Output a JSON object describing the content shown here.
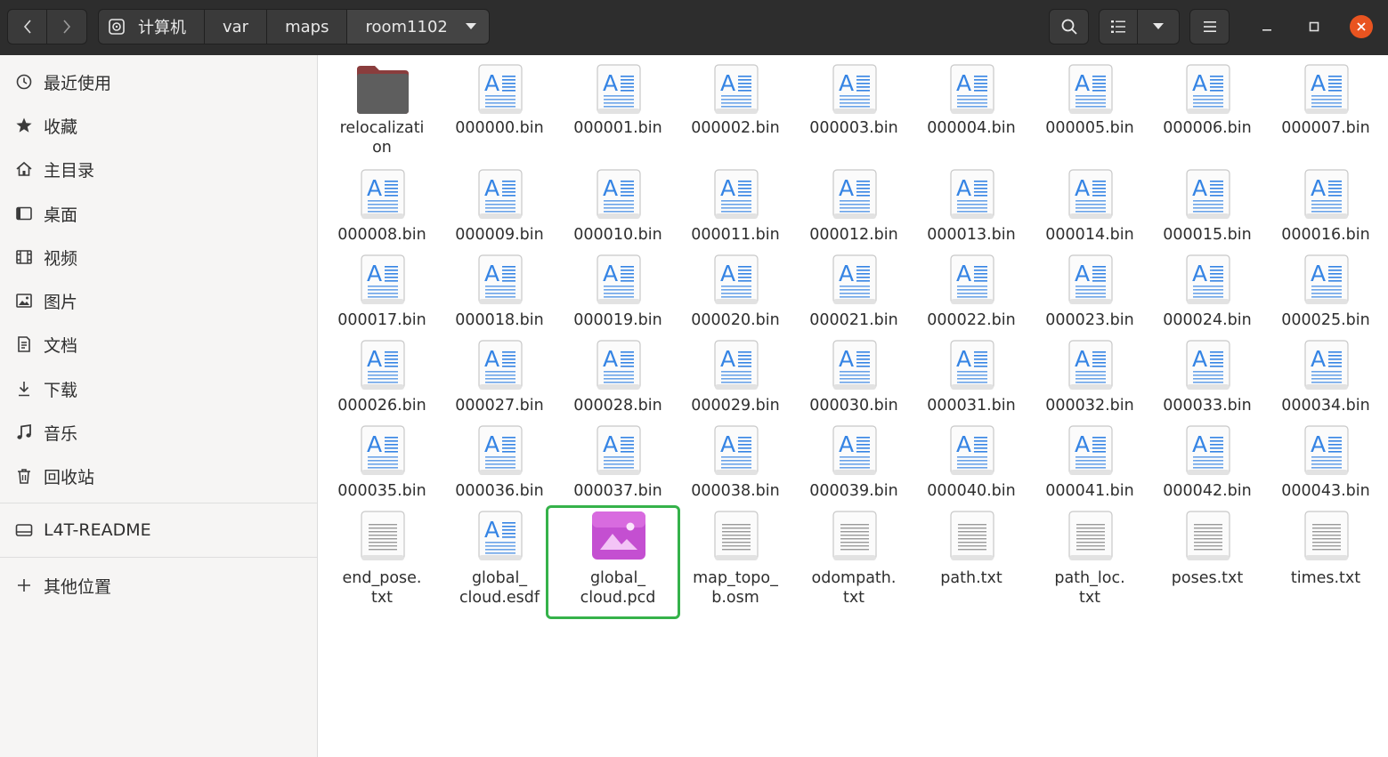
{
  "header": {
    "path": [
      "计算机",
      "var",
      "maps",
      "room1102"
    ],
    "icons": {
      "back": "chevron-left-icon",
      "forward": "chevron-right-icon",
      "search": "search-icon",
      "view": "list-view-icon",
      "menu": "hamburger-menu-icon"
    }
  },
  "sidebar": {
    "places": [
      {
        "label": "最近使用",
        "icon": "recent-icon"
      },
      {
        "label": "收藏",
        "icon": "star-icon"
      },
      {
        "label": "主目录",
        "icon": "home-icon"
      },
      {
        "label": "桌面",
        "icon": "desktop-icon"
      },
      {
        "label": "视频",
        "icon": "video-icon"
      },
      {
        "label": "图片",
        "icon": "pictures-icon"
      },
      {
        "label": "文档",
        "icon": "documents-icon"
      },
      {
        "label": "下载",
        "icon": "download-icon"
      },
      {
        "label": "音乐",
        "icon": "music-icon"
      },
      {
        "label": "回收站",
        "icon": "trash-icon"
      }
    ],
    "devices": [
      {
        "label": "L4T-README",
        "icon": "drive-icon"
      }
    ],
    "other": {
      "label": "其他位置",
      "icon": "plus-icon"
    }
  },
  "files": [
    {
      "name": "relocalizati\non",
      "type": "folder"
    },
    {
      "name": "000000.bin",
      "type": "bin"
    },
    {
      "name": "000001.bin",
      "type": "bin"
    },
    {
      "name": "000002.bin",
      "type": "bin"
    },
    {
      "name": "000003.bin",
      "type": "bin"
    },
    {
      "name": "000004.bin",
      "type": "bin"
    },
    {
      "name": "000005.bin",
      "type": "bin"
    },
    {
      "name": "000006.bin",
      "type": "bin"
    },
    {
      "name": "000007.bin",
      "type": "bin"
    },
    {
      "name": "000008.bin",
      "type": "bin"
    },
    {
      "name": "000009.bin",
      "type": "bin"
    },
    {
      "name": "000010.bin",
      "type": "bin"
    },
    {
      "name": "000011.bin",
      "type": "bin"
    },
    {
      "name": "000012.bin",
      "type": "bin"
    },
    {
      "name": "000013.bin",
      "type": "bin"
    },
    {
      "name": "000014.bin",
      "type": "bin"
    },
    {
      "name": "000015.bin",
      "type": "bin"
    },
    {
      "name": "000016.bin",
      "type": "bin"
    },
    {
      "name": "000017.bin",
      "type": "bin"
    },
    {
      "name": "000018.bin",
      "type": "bin"
    },
    {
      "name": "000019.bin",
      "type": "bin"
    },
    {
      "name": "000020.bin",
      "type": "bin"
    },
    {
      "name": "000021.bin",
      "type": "bin"
    },
    {
      "name": "000022.bin",
      "type": "bin"
    },
    {
      "name": "000023.bin",
      "type": "bin"
    },
    {
      "name": "000024.bin",
      "type": "bin"
    },
    {
      "name": "000025.bin",
      "type": "bin"
    },
    {
      "name": "000026.bin",
      "type": "bin"
    },
    {
      "name": "000027.bin",
      "type": "bin"
    },
    {
      "name": "000028.bin",
      "type": "bin"
    },
    {
      "name": "000029.bin",
      "type": "bin"
    },
    {
      "name": "000030.bin",
      "type": "bin"
    },
    {
      "name": "000031.bin",
      "type": "bin"
    },
    {
      "name": "000032.bin",
      "type": "bin"
    },
    {
      "name": "000033.bin",
      "type": "bin"
    },
    {
      "name": "000034.bin",
      "type": "bin"
    },
    {
      "name": "000035.bin",
      "type": "bin"
    },
    {
      "name": "000036.bin",
      "type": "bin"
    },
    {
      "name": "000037.bin",
      "type": "bin"
    },
    {
      "name": "000038.bin",
      "type": "bin"
    },
    {
      "name": "000039.bin",
      "type": "bin"
    },
    {
      "name": "000040.bin",
      "type": "bin"
    },
    {
      "name": "000041.bin",
      "type": "bin"
    },
    {
      "name": "000042.bin",
      "type": "bin"
    },
    {
      "name": "000043.bin",
      "type": "bin"
    },
    {
      "name": "end_pose.\ntxt",
      "type": "text"
    },
    {
      "name": "global_\ncloud.esdf",
      "type": "bin"
    },
    {
      "name": "global_\ncloud.pcd",
      "type": "image",
      "highlighted": true
    },
    {
      "name": "map_topo_\nb.osm",
      "type": "text"
    },
    {
      "name": "odompath.\ntxt",
      "type": "text"
    },
    {
      "name": "path.txt",
      "type": "text"
    },
    {
      "name": "path_loc.\ntxt",
      "type": "text"
    },
    {
      "name": "poses.txt",
      "type": "text"
    },
    {
      "name": "times.txt",
      "type": "text"
    }
  ],
  "colors": {
    "accent": "#e95420",
    "highlight": "#35b24a",
    "folder": "#5e5e5e",
    "pcd_icon": "#c44fd1"
  }
}
